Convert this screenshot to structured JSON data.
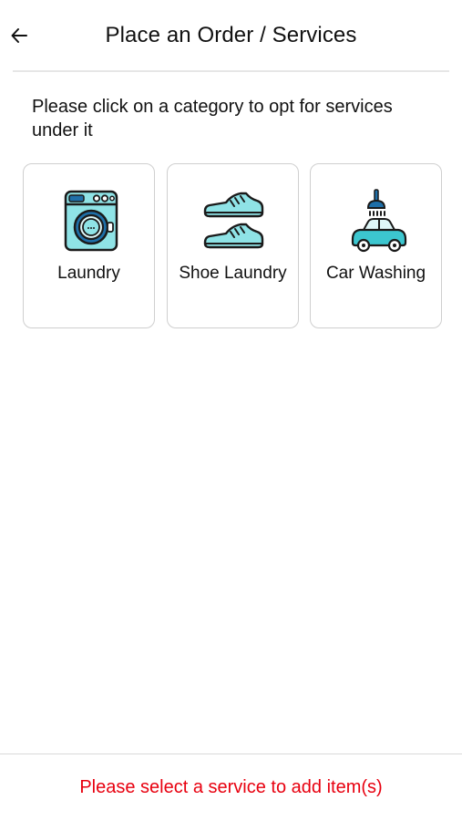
{
  "header": {
    "title": "Place an Order / Services",
    "back_icon": "arrow-left-icon"
  },
  "instruction": "Please click on a category to opt for services under it",
  "categories": [
    {
      "label": "Laundry",
      "icon": "washing-machine-icon"
    },
    {
      "label": "Shoe Laundry",
      "icon": "shoes-icon"
    },
    {
      "label": "Car Washing",
      "icon": "car-wash-icon"
    }
  ],
  "footer": {
    "message": "Please select a service to add item(s)",
    "message_color": "#e8000f"
  },
  "colors": {
    "icon_fill": "#8fe3e6",
    "icon_accent": "#1f6fa8",
    "icon_stroke": "#1a1a1a"
  }
}
